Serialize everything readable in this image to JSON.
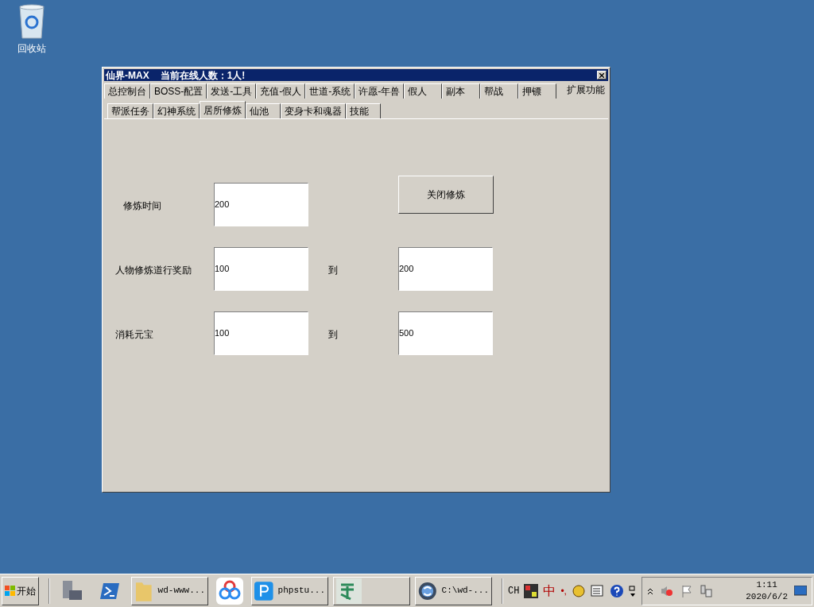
{
  "desktop_icons": [
    {
      "label": "回收站"
    }
  ],
  "window": {
    "title": "仙界-MAX",
    "online": "当前在线人数：1人!",
    "tabs": [
      {
        "label": "总控制台",
        "selected": false
      },
      {
        "label": "BOSS-配置",
        "selected": false
      },
      {
        "label": "发送-工具",
        "selected": false
      },
      {
        "label": "充值-假人",
        "selected": false
      },
      {
        "label": "世道-系统",
        "selected": false
      },
      {
        "label": "许愿-年兽",
        "selected": false
      },
      {
        "label": "假人",
        "selected": false
      },
      {
        "label": "副本",
        "selected": false
      },
      {
        "label": "帮战",
        "selected": false
      },
      {
        "label": "押镖",
        "selected": false
      },
      {
        "label": "扩展功能",
        "selected": true
      }
    ],
    "subtabs": [
      {
        "label": "帮派任务",
        "selected": false
      },
      {
        "label": "幻神系统",
        "selected": false
      },
      {
        "label": "居所修炼",
        "selected": true
      },
      {
        "label": "仙池",
        "selected": false
      },
      {
        "label": "变身卡和魂器",
        "selected": false
      },
      {
        "label": "技能",
        "selected": false
      }
    ],
    "rows": [
      {
        "label": "修炼时间",
        "value": "200",
        "button": "关闭修炼"
      },
      {
        "label": "人物修炼道行奖励",
        "value": "100",
        "to": "到",
        "value2": "200"
      },
      {
        "label": "消耗元宝",
        "value": "100",
        "to": "到",
        "value2": "500"
      }
    ]
  },
  "taskbar": {
    "start": "开始",
    "items": [
      {
        "kind": "tool"
      },
      {
        "kind": "shell"
      },
      {
        "kind": "folder",
        "label": "wd-www..."
      },
      {
        "kind": "cloud"
      },
      {
        "kind": "php",
        "label": "phpstu..."
      },
      {
        "kind": "app"
      },
      {
        "kind": "disc",
        "label": "C:\\wd-..."
      }
    ],
    "language": "CH",
    "ime": "中",
    "punct": "•,",
    "time": "1:11",
    "date": "2020/6/2"
  }
}
